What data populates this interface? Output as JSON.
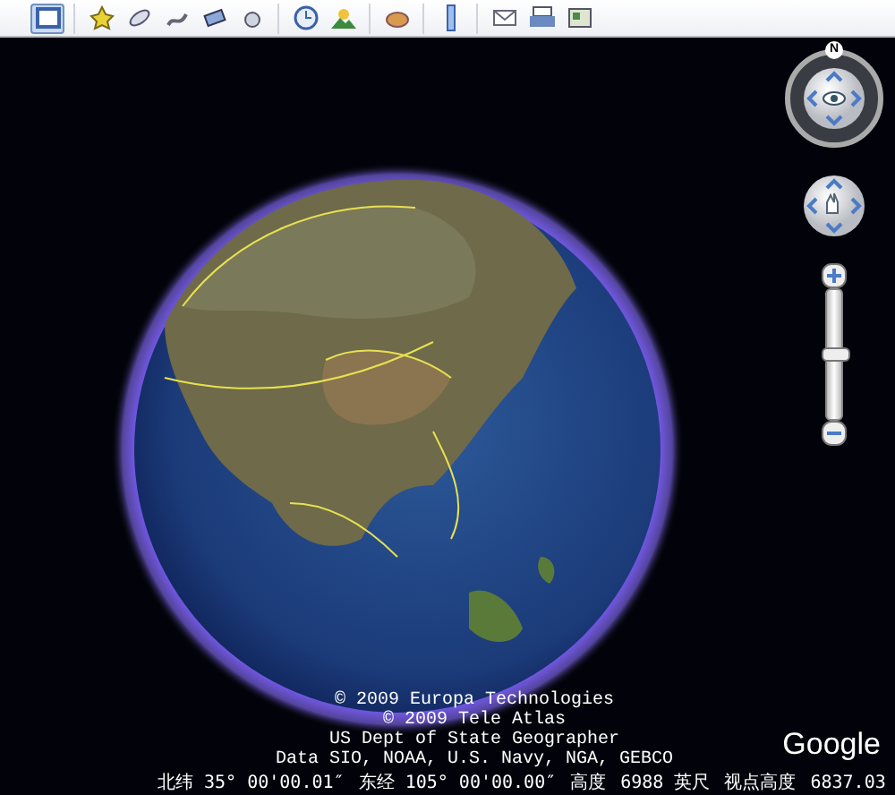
{
  "toolbar": {
    "groups": [
      [
        {
          "selected": true
        }
      ],
      [
        {
          "selected": false
        },
        {
          "selected": false
        },
        {
          "selected": false
        },
        {
          "selected": false
        },
        {
          "selected": false
        }
      ],
      [
        {
          "selected": false
        },
        {
          "selected": false
        }
      ],
      [
        {
          "selected": false
        }
      ],
      [
        {
          "selected": false
        }
      ],
      [
        {
          "selected": false
        },
        {
          "selected": false
        },
        {
          "selected": false
        }
      ]
    ]
  },
  "navigation": {
    "compass_label": "N",
    "zoom": {
      "level": 0.5
    }
  },
  "attribution": [
    "© 2009 Europa Technologies",
    "© 2009 Tele Atlas",
    "US Dept of State Geographer",
    "Data SIO, NOAA, U.S. Navy, NGA, GEBCO"
  ],
  "logo": "Google",
  "status_bar": {
    "latitude": "北纬 35° 00'00.01″",
    "longitude": "东经 105° 00'00.00″",
    "elevation_label": "高度",
    "elevation": "6988 英尺",
    "eye_alt_label": "视点高度",
    "eye_alt": "6837.03"
  }
}
